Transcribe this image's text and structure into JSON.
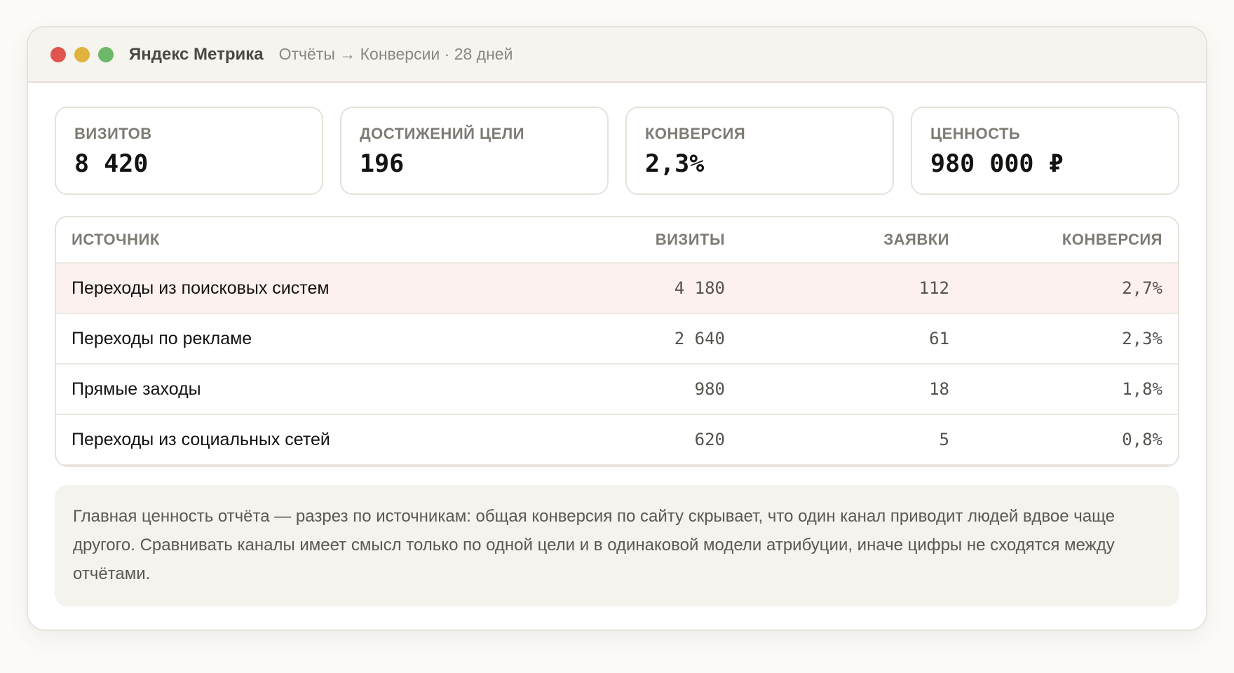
{
  "window": {
    "app_title": "Яндекс Метрика",
    "breadcrumb": "Отчёты → Конверсии · 28 дней"
  },
  "kpis": [
    {
      "label": "Визитов",
      "value": "8 420"
    },
    {
      "label": "Достижений цели",
      "value": "196"
    },
    {
      "label": "Конверсия",
      "value": "2,3%"
    },
    {
      "label": "Ценность",
      "value": "980 000 ₽"
    }
  ],
  "table": {
    "columns": [
      "Источник",
      "Визиты",
      "Заявки",
      "Конверсия"
    ],
    "rows": [
      {
        "source": "Переходы из поисковых систем",
        "visits": "4 180",
        "leads": "112",
        "conversion": "2,7%"
      },
      {
        "source": "Переходы по рекламе",
        "visits": "2 640",
        "leads": "61",
        "conversion": "2,3%"
      },
      {
        "source": "Прямые заходы",
        "visits": "980",
        "leads": "18",
        "conversion": "1,8%"
      },
      {
        "source": "Переходы из социальных сетей",
        "visits": "620",
        "leads": "5",
        "conversion": "0,8%"
      }
    ]
  },
  "note": "Главная ценность отчёта — разрез по источникам: общая конверсия по сайту скрывает, что один канал приводит людей вдвое чаще другого. Сравнивать каналы имеет смысл только по одной цели и в одинаковой модели атрибуции, иначе цифры не сходятся между отчётами.",
  "colors": {
    "close": "#e0554d",
    "minimize": "#e2b23e",
    "maximize": "#6db868",
    "highlight_row": "#fcf1ef"
  }
}
